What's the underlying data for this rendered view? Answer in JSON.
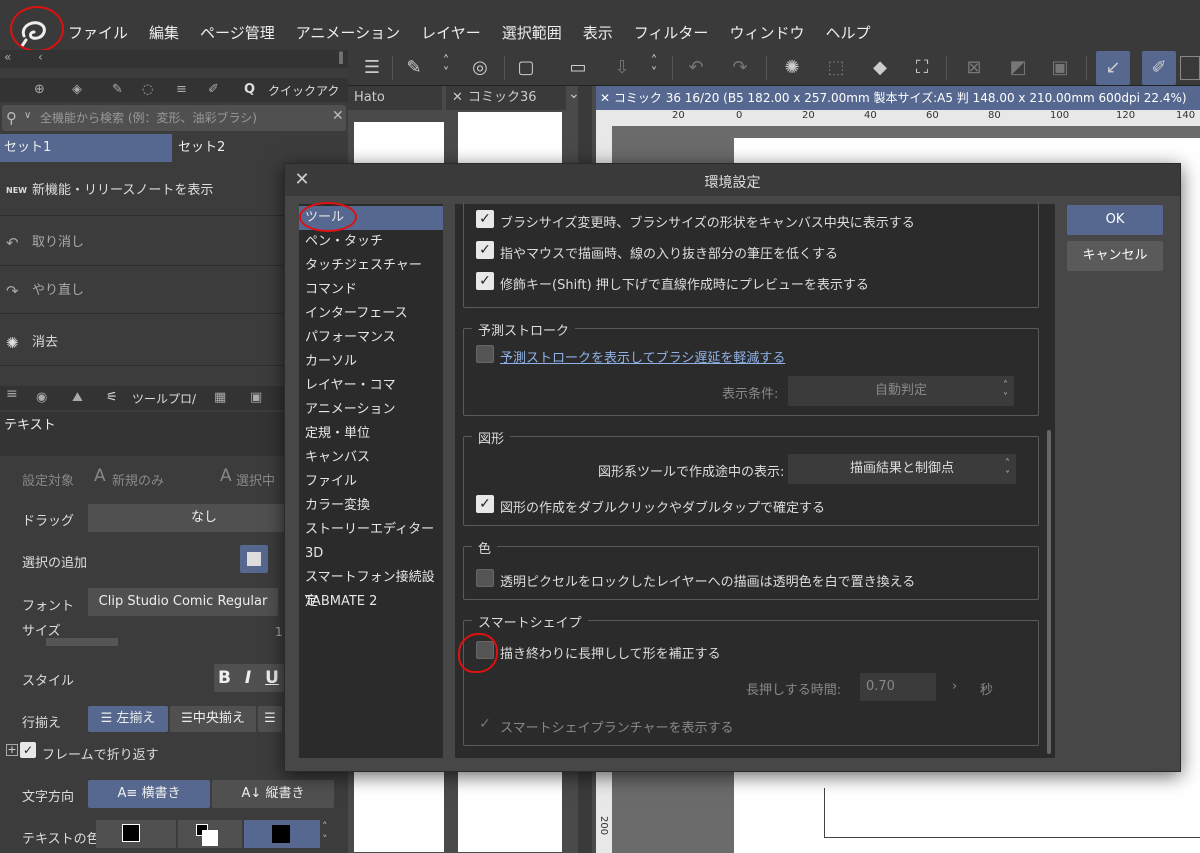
{
  "menubar": {
    "items": [
      "ファイル",
      "編集",
      "ページ管理",
      "アニメーション",
      "レイヤー",
      "選択範囲",
      "表示",
      "フィルター",
      "ウィンドウ",
      "ヘルプ"
    ]
  },
  "left_panel": {
    "quick_access_label": "クイックアク",
    "search_placeholder": "全機能から検索 (例：変形、油彩ブラシ)",
    "sets": [
      "セット1",
      "セット2"
    ],
    "commands": [
      "新機能・リリースノートを表示",
      "取り消し",
      "やり直し",
      "消去"
    ],
    "new_badge": "NEW",
    "tool_property_label": "ツールプロ/",
    "tool_name": "テキスト",
    "target_label": "設定対象",
    "target_new_only": "新規のみ",
    "target_selected": "選択中",
    "drag_label": "ドラッグ",
    "drag_value": "なし",
    "add_selection_label": "選択の追加",
    "font_label": "フォント",
    "font_value": "Clip Studio Comic Regular",
    "size_label": "サイズ",
    "size_value": "1",
    "style_label": "スタイル",
    "align_label": "行揃え",
    "align_left": "左揃え",
    "align_center": "中央揃え",
    "wrap_label": "フレームで折り返す",
    "direction_label": "文字方向",
    "dir_horizontal": "横書き",
    "dir_vertical": "縦書き",
    "text_color_label": "テキストの色"
  },
  "docs": {
    "tab1": "Hato",
    "tab2": "コミック36",
    "canvas_title": "コミック 36 16/20 (B5 182.00 x 257.00mm 製本サイズ:A5 判 148.00 x 210.00mm 600dpi 22.4%)",
    "ruler_labels": [
      "20",
      "0",
      "20",
      "40",
      "60",
      "80",
      "100",
      "120",
      "140"
    ],
    "vruler_label": "200"
  },
  "dialog": {
    "title": "環境設定",
    "ok": "OK",
    "cancel": "キャンセル",
    "categories": [
      "ツール",
      "ペン・タッチ",
      "タッチジェスチャー",
      "コマンド",
      "インターフェース",
      "パフォーマンス",
      "カーソル",
      "レイヤー・コマ",
      "アニメーション",
      "定規・単位",
      "キャンバス",
      "ファイル",
      "カラー変換",
      "ストーリーエディター",
      "3D",
      "スマートフォン接続設定",
      "TABMATE 2"
    ],
    "selected_category": "ツール",
    "options_top": [
      {
        "label": "ブラシサイズ変更時、ブラシサイズの形状をキャンバス中央に表示する",
        "checked": true
      },
      {
        "label": "指やマウスで描画時、線の入り抜き部分の筆圧を低くする",
        "checked": true
      },
      {
        "label": "修飾キー(Shift) 押し下げで直線作成時にプレビューを表示する",
        "checked": true
      }
    ],
    "predictive": {
      "title": "予測ストローク",
      "option": "予測ストロークを表示してブラシ遅延を軽減する",
      "checked": false,
      "condition_label": "表示条件:",
      "condition_value": "自動判定"
    },
    "shape": {
      "title": "図形",
      "display_label": "図形系ツールで作成途中の表示:",
      "display_value": "描画結果と制御点",
      "option": "図形の作成をダブルクリックやダブルタップで確定する",
      "checked": true
    },
    "color": {
      "title": "色",
      "option": "透明ピクセルをロックしたレイヤーへの描画は透明色を白で置き換える",
      "checked": false
    },
    "smart_shape": {
      "title": "スマートシェイプ",
      "option": "描き終わりに長押しして形を補正する",
      "checked": false,
      "hold_label": "長押しする時間:",
      "hold_value": "0.70",
      "hold_unit": "秒",
      "launcher_option": "スマートシェイプランチャーを表示する"
    }
  }
}
